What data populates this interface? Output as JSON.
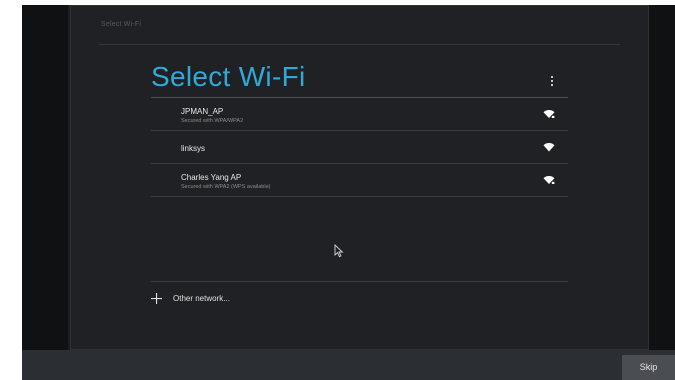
{
  "window": {
    "top_title": "Select Wi-Fi"
  },
  "main": {
    "heading": "Select Wi-Fi",
    "overflow_icon": "overflow-menu-icon",
    "networks": [
      {
        "name": "JPMAN_AP",
        "security": "Secured with WPA/WPA2",
        "icon": "wifi-secured-icon"
      },
      {
        "name": "linksys",
        "security": "",
        "icon": "wifi-open-icon"
      },
      {
        "name": "Charles Yang AP",
        "security": "Secured with WPA2 (WPS available)",
        "icon": "wifi-secured-icon"
      }
    ],
    "other_network": {
      "icon": "plus-icon",
      "label": "Other network..."
    }
  },
  "footer": {
    "skip_label": "Skip"
  },
  "colors": {
    "accent": "#31a9d8",
    "background": "#1f2124",
    "text": "#e8e8e8"
  }
}
